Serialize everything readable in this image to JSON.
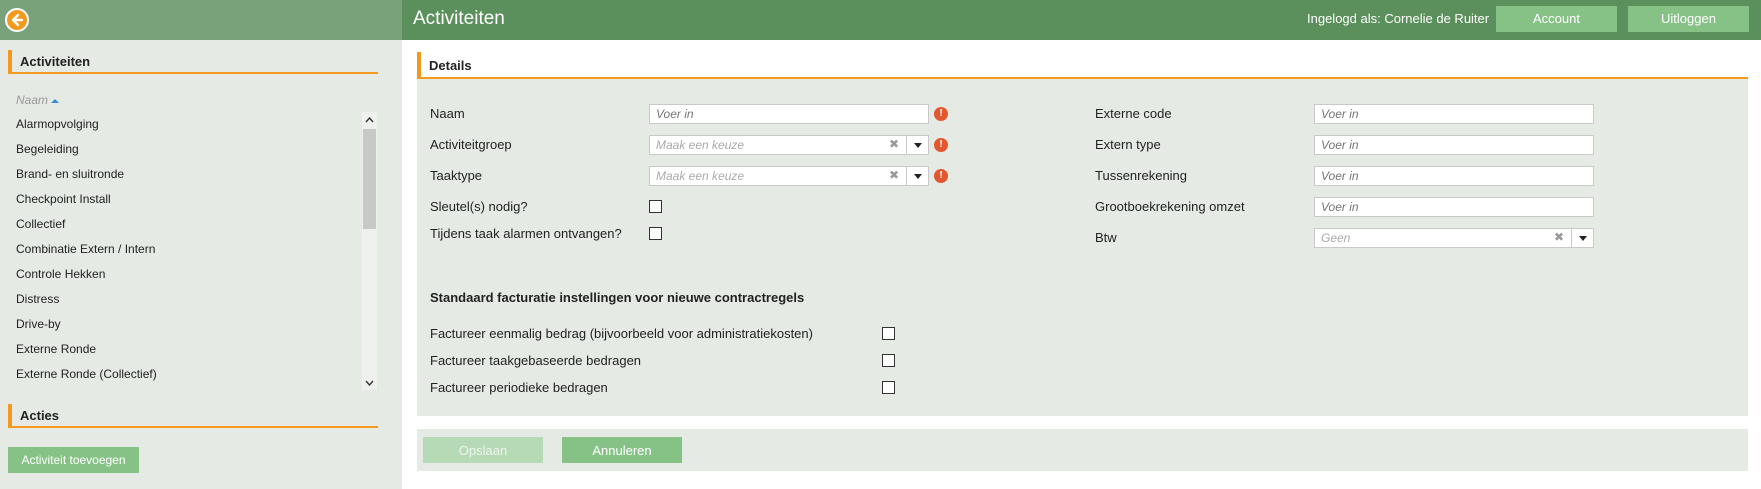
{
  "header": {
    "title": "Activiteiten",
    "logged_in_text": "Ingelogd als: Cornelie de Ruiter",
    "account_label": "Account",
    "logout_label": "Uitloggen",
    "accent_color": "#5b8f5b"
  },
  "sidebar": {
    "activities_heading": "Activiteiten",
    "sort_column": "Naam",
    "items": [
      "Alarmopvolging",
      "Begeleiding",
      "Brand- en sluitronde",
      "Checkpoint Install",
      "Collectief",
      "Combinatie Extern / Intern",
      "Controle Hekken",
      "Distress",
      "Drive-by",
      "Externe Ronde",
      "Externe Ronde (Collectief)"
    ],
    "actions_heading": "Acties",
    "add_button_label": "Activiteit toevoegen"
  },
  "details": {
    "heading": "Details",
    "left": {
      "naam_label": "Naam",
      "naam_placeholder": "Voer in",
      "activiteitgroep_label": "Activiteitgroep",
      "activiteitgroep_placeholder": "Maak een keuze",
      "taaktype_label": "Taaktype",
      "taaktype_placeholder": "Maak een keuze",
      "sleutel_label": "Sleutel(s) nodig?",
      "alarmen_label": "Tijdens taak alarmen ontvangen?"
    },
    "right": {
      "externe_code_label": "Externe code",
      "externe_code_placeholder": "Voer in",
      "extern_type_label": "Extern type",
      "extern_type_placeholder": "Voer in",
      "tussenrekening_label": "Tussenrekening",
      "tussenrekening_placeholder": "Voer in",
      "grootboek_label": "Grootboekrekening omzet",
      "grootboek_placeholder": "Voer in",
      "btw_label": "Btw",
      "btw_value": "Geen"
    },
    "billing": {
      "heading": "Standaard facturatie instellingen voor nieuwe contractregels",
      "eenmalig_label": "Factureer eenmalig bedrag (bijvoorbeeld voor administratiekosten)",
      "taak_label": "Factureer taakgebaseerde bedragen",
      "periodiek_label": "Factureer periodieke bedragen"
    }
  },
  "footer": {
    "save_label": "Opslaan",
    "cancel_label": "Annuleren"
  }
}
